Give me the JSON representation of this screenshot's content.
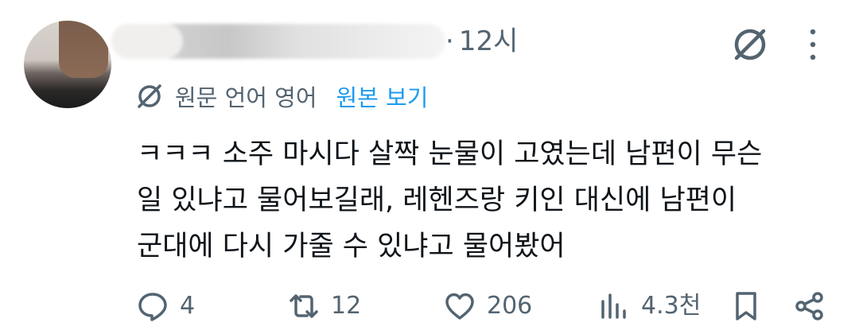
{
  "post": {
    "time_separator": "·",
    "time": "12시",
    "translate": {
      "source_language": "원문 언어 영어",
      "show_original": "원본 보기"
    },
    "content": {
      "lines": [
        "ㅋㅋㅋ 소주 마시다 살짝 눈물이 고였는데 남편이 무슨",
        "일 있냐고 물어보길래, 레헨즈랑 키인 대신에 남편이",
        "군대에 다시 가줄 수 있냐고 물어봤어"
      ]
    },
    "actions": {
      "replies": "4",
      "reposts": "12",
      "likes": "206",
      "views": "4.3천"
    },
    "icons": {
      "hide": "hide-reply-icon",
      "more": "more-vertical-icon",
      "translate": "translate-icon",
      "reply": "reply-icon",
      "repost": "repost-icon",
      "like": "heart-icon",
      "views": "views-chart-icon",
      "bookmark": "bookmark-icon",
      "share": "share-icon"
    },
    "colors": {
      "text": "#0f1419",
      "secondary": "#536471",
      "link": "#1d9bf0"
    }
  }
}
